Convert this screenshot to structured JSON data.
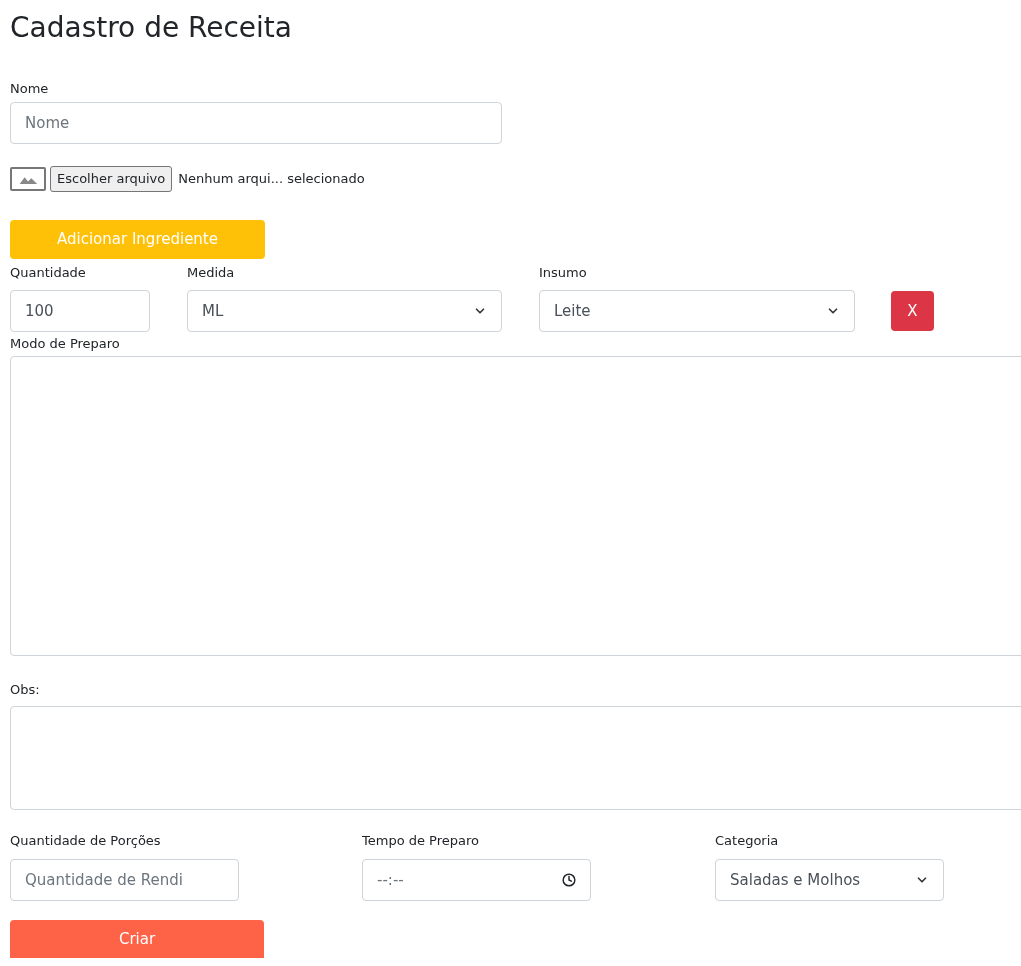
{
  "title": "Cadastro de Receita",
  "nome": {
    "label": "Nome",
    "placeholder": "Nome"
  },
  "file": {
    "button": "Escolher arquivo",
    "status": "Nenhum arqui... selecionado"
  },
  "add_button": "Adicionar Ingrediente",
  "ingredient": {
    "quantidade": {
      "label": "Quantidade",
      "value": "100"
    },
    "medida": {
      "label": "Medida",
      "value": "ML"
    },
    "insumo": {
      "label": "Insumo",
      "value": "Leite"
    },
    "remove": "X"
  },
  "modo": {
    "label": "Modo de Preparo"
  },
  "obs": {
    "label": "Obs:"
  },
  "porcoes": {
    "label": "Quantidade de Porções",
    "placeholder": "Quantidade de Rendi"
  },
  "tempo": {
    "label": "Tempo de Preparo",
    "value": "--:--"
  },
  "categoria": {
    "label": "Categoria",
    "value": "Saladas e Molhos"
  },
  "submit": "Criar"
}
